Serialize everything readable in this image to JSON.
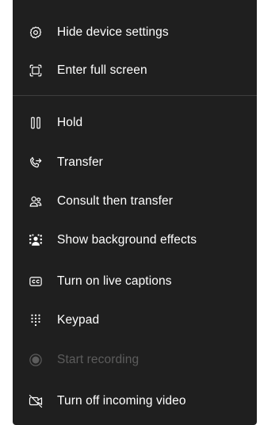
{
  "menu": {
    "items": [
      {
        "label": "Hide device settings",
        "icon": "gear-icon"
      },
      {
        "label": "Enter full screen",
        "icon": "fullscreen-icon"
      },
      {
        "label": "Hold",
        "icon": "pause-icon"
      },
      {
        "label": "Transfer",
        "icon": "call-transfer-icon"
      },
      {
        "label": "Consult then transfer",
        "icon": "people-icon"
      },
      {
        "label": "Show background effects",
        "icon": "background-effects-icon"
      },
      {
        "label": "Turn on live captions",
        "icon": "closed-captions-icon"
      },
      {
        "label": "Keypad",
        "icon": "keypad-icon"
      },
      {
        "label": "Start recording",
        "icon": "record-icon",
        "disabled": true
      },
      {
        "label": "Turn off incoming video",
        "icon": "video-off-icon"
      }
    ]
  },
  "colors": {
    "menu_background": "#1f1f1f",
    "text": "#ffffff",
    "disabled_text": "#5c5c5c",
    "divider": "#3d3d3d"
  }
}
